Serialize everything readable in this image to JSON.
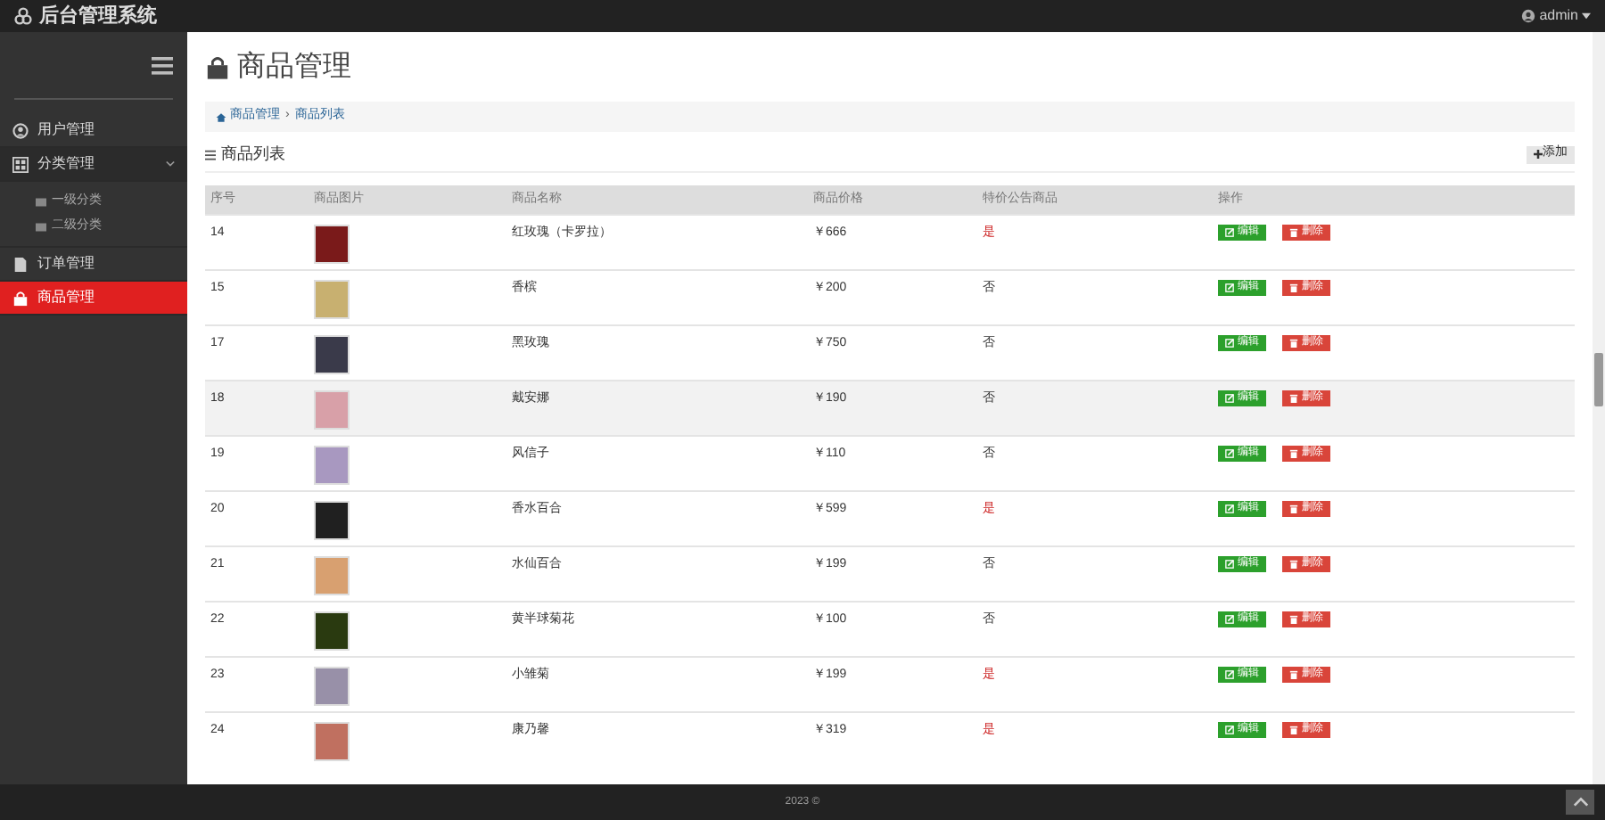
{
  "app_title": "后台管理系统",
  "user": "admin",
  "sidebar": {
    "items": [
      {
        "label": "用户管理",
        "selected": false
      },
      {
        "label": "分类管理",
        "selected": false,
        "expanded": true,
        "children": [
          {
            "label": "一级分类",
            "selected": false
          },
          {
            "label": "二级分类",
            "selected": false
          }
        ]
      },
      {
        "label": "订单管理",
        "selected": false
      },
      {
        "label": "商品管理",
        "selected": true
      }
    ]
  },
  "page_title": "商品管理",
  "breadcrumb": [
    "商品管理",
    "›",
    "商品列表"
  ],
  "section_title": "商品列表",
  "add_button": "添加",
  "table": {
    "columns": [
      "序号",
      "商品图片",
      "商品名称",
      "商品价格",
      "特价公告商品",
      "操作"
    ],
    "rows": [
      {
        "id": "14",
        "name": "红玫瑰（卡罗拉）",
        "price": "￥666",
        "special": "是",
        "special_on": true,
        "highlighted": false,
        "edit": "编辑",
        "delete": "删除"
      },
      {
        "id": "15",
        "name": "香槟",
        "price": "￥200",
        "special": "否",
        "special_on": false,
        "highlighted": false,
        "edit": "编辑",
        "delete": "删除"
      },
      {
        "id": "17",
        "name": "黑玫瑰",
        "price": "￥750",
        "special": "否",
        "special_on": false,
        "highlighted": false,
        "edit": "编辑",
        "delete": "删除"
      },
      {
        "id": "18",
        "name": "戴安娜",
        "price": "￥190",
        "special": "否",
        "special_on": false,
        "highlighted": true,
        "edit": "编辑",
        "delete": "删除"
      },
      {
        "id": "19",
        "name": "风信子",
        "price": "￥110",
        "special": "否",
        "special_on": false,
        "highlighted": false,
        "edit": "编辑",
        "delete": "删除"
      },
      {
        "id": "20",
        "name": "香水百合",
        "price": "￥599",
        "special": "是",
        "special_on": true,
        "highlighted": false,
        "edit": "编辑",
        "delete": "删除"
      },
      {
        "id": "21",
        "name": "水仙百合",
        "price": "￥199",
        "special": "否",
        "special_on": false,
        "highlighted": false,
        "edit": "编辑",
        "delete": "删除"
      },
      {
        "id": "22",
        "name": "黄半球菊花",
        "price": "￥100",
        "special": "否",
        "special_on": false,
        "highlighted": false,
        "edit": "编辑",
        "delete": "删除"
      },
      {
        "id": "23",
        "name": "小雏菊",
        "price": "￥199",
        "special": "是",
        "special_on": true,
        "highlighted": false,
        "edit": "编辑",
        "delete": "删除"
      },
      {
        "id": "24",
        "name": "康乃馨",
        "price": "￥319",
        "special": "是",
        "special_on": true,
        "highlighted": false,
        "edit": "编辑",
        "delete": "删除"
      }
    ]
  },
  "footer": "2023 ©"
}
